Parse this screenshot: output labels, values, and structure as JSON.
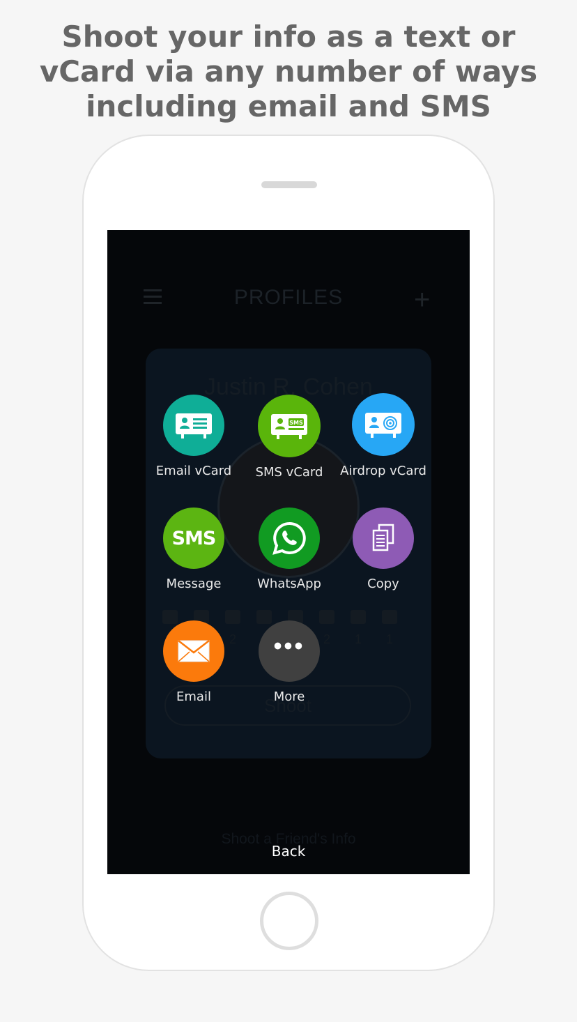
{
  "headline": {
    "lines": [
      "Shoot your info as a text or",
      "vCard via any number of ways",
      "including email and SMS"
    ]
  },
  "background_app": {
    "title": "PROFILES",
    "profile_name": "Justin R. Cohen",
    "stats": [
      "2",
      "2",
      "2",
      "",
      "",
      "2",
      "1",
      "1"
    ],
    "shoot_label": "Shoot",
    "friend_link": "Shoot a Friend's Info"
  },
  "share_options": [
    {
      "label": "Email vCard",
      "icon": "email-vcard-icon",
      "color": "#0fae97"
    },
    {
      "label": "SMS vCard",
      "icon": "sms-vcard-icon",
      "color": "#5ab50b"
    },
    {
      "label": "Airdrop vCard",
      "icon": "airdrop-vcard-icon",
      "color": "#27a7f5"
    },
    {
      "label": "Message",
      "icon": "sms-icon",
      "icon_text": "SMS",
      "color": "#5cb512"
    },
    {
      "label": "WhatsApp",
      "icon": "whatsapp-icon",
      "color": "#119b22"
    },
    {
      "label": "Copy",
      "icon": "copy-icon",
      "color": "#8e5bb5"
    },
    {
      "label": "Email",
      "icon": "envelope-icon",
      "color": "#fb7a0c"
    },
    {
      "label": "More",
      "icon": "more-icon",
      "icon_text": "•••",
      "color": "#404040"
    }
  ],
  "back_label": "Back"
}
